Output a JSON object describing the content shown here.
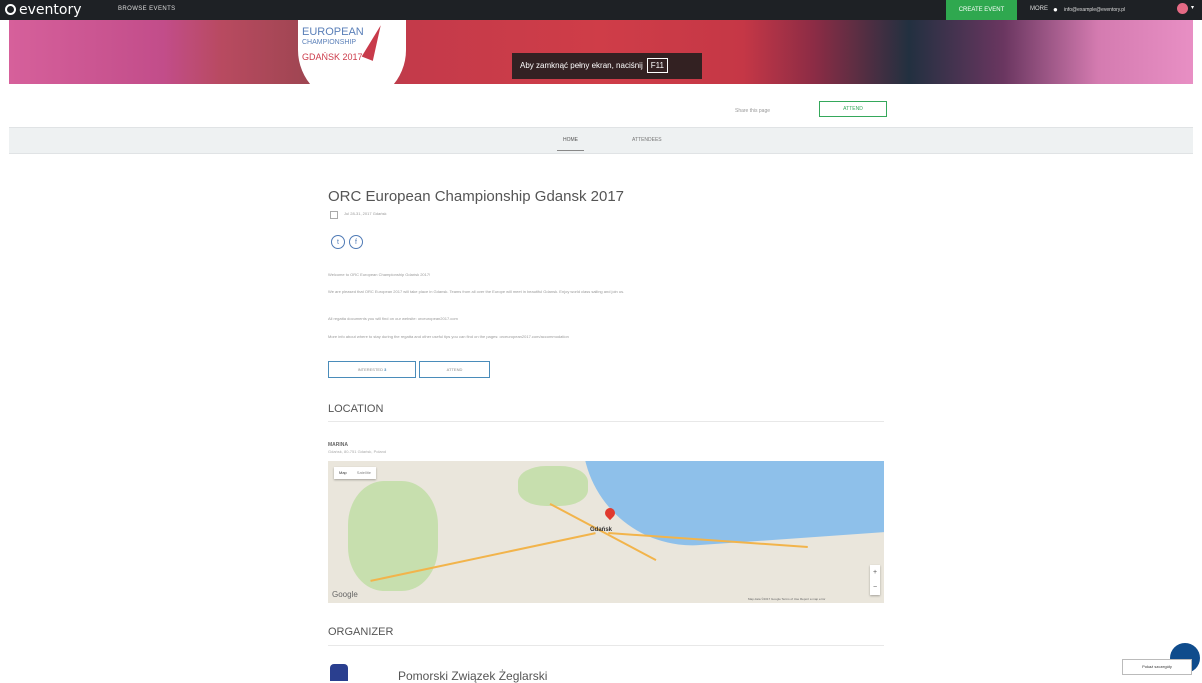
{
  "nav": {
    "logo": "eventory",
    "browse": "BROWSE EVENTS",
    "create": "CREATE EVENT",
    "more": "MORE",
    "user_email": "info@example@eventory.pl"
  },
  "hero": {
    "tooltip": "Aby zamknąć pełny ekran, naciśnij",
    "tooltip_key": "F11",
    "logo_line1": "EUROPEAN",
    "logo_line2": "CHAMPIONSHIP",
    "logo_line3": "GDAŃSK 2017"
  },
  "actions": {
    "share": "Share this page",
    "attend": "ATTEND"
  },
  "tabs": {
    "home": "HOME",
    "attendees": "ATTENDEES"
  },
  "event": {
    "title": "ORC European Championship Gdansk 2017",
    "date": "Jul 28-31, 2017 Gdańsk",
    "paragraphs": [
      "Welcome to ORC European Championship Gdańsk 2017!",
      "We are pleased that ORC European 2017 will take place in Gdansk. Teams from all over the Europe will meet in beautiful Gdansk. Enjoy world class sailing and join us.",
      "All regatta documents you will find on our website: orceuropean2017.com",
      "More info about where to stay during the regatta and other useful tips you can find on the pages: orceuropean2017.com/accommodation"
    ],
    "btn_interested": "INTERESTED",
    "btn_interested_count": "3",
    "btn_attend": "ATTEND"
  },
  "location": {
    "heading": "LOCATION",
    "venue": "MARINA",
    "address": "Gdańsk, 80-751 Gdańsk, Poland",
    "map_type_map": "Map",
    "map_type_sat": "Satellite",
    "city": "Gdańsk",
    "google": "Google",
    "map_copyright": "Map data ©2017 Google  Terms of Use  Report a map error"
  },
  "organizer": {
    "heading": "ORGANIZER",
    "name": "Pomorski Związek Żeglarski"
  },
  "chat": {
    "label": "Pokaż szczegóły"
  }
}
